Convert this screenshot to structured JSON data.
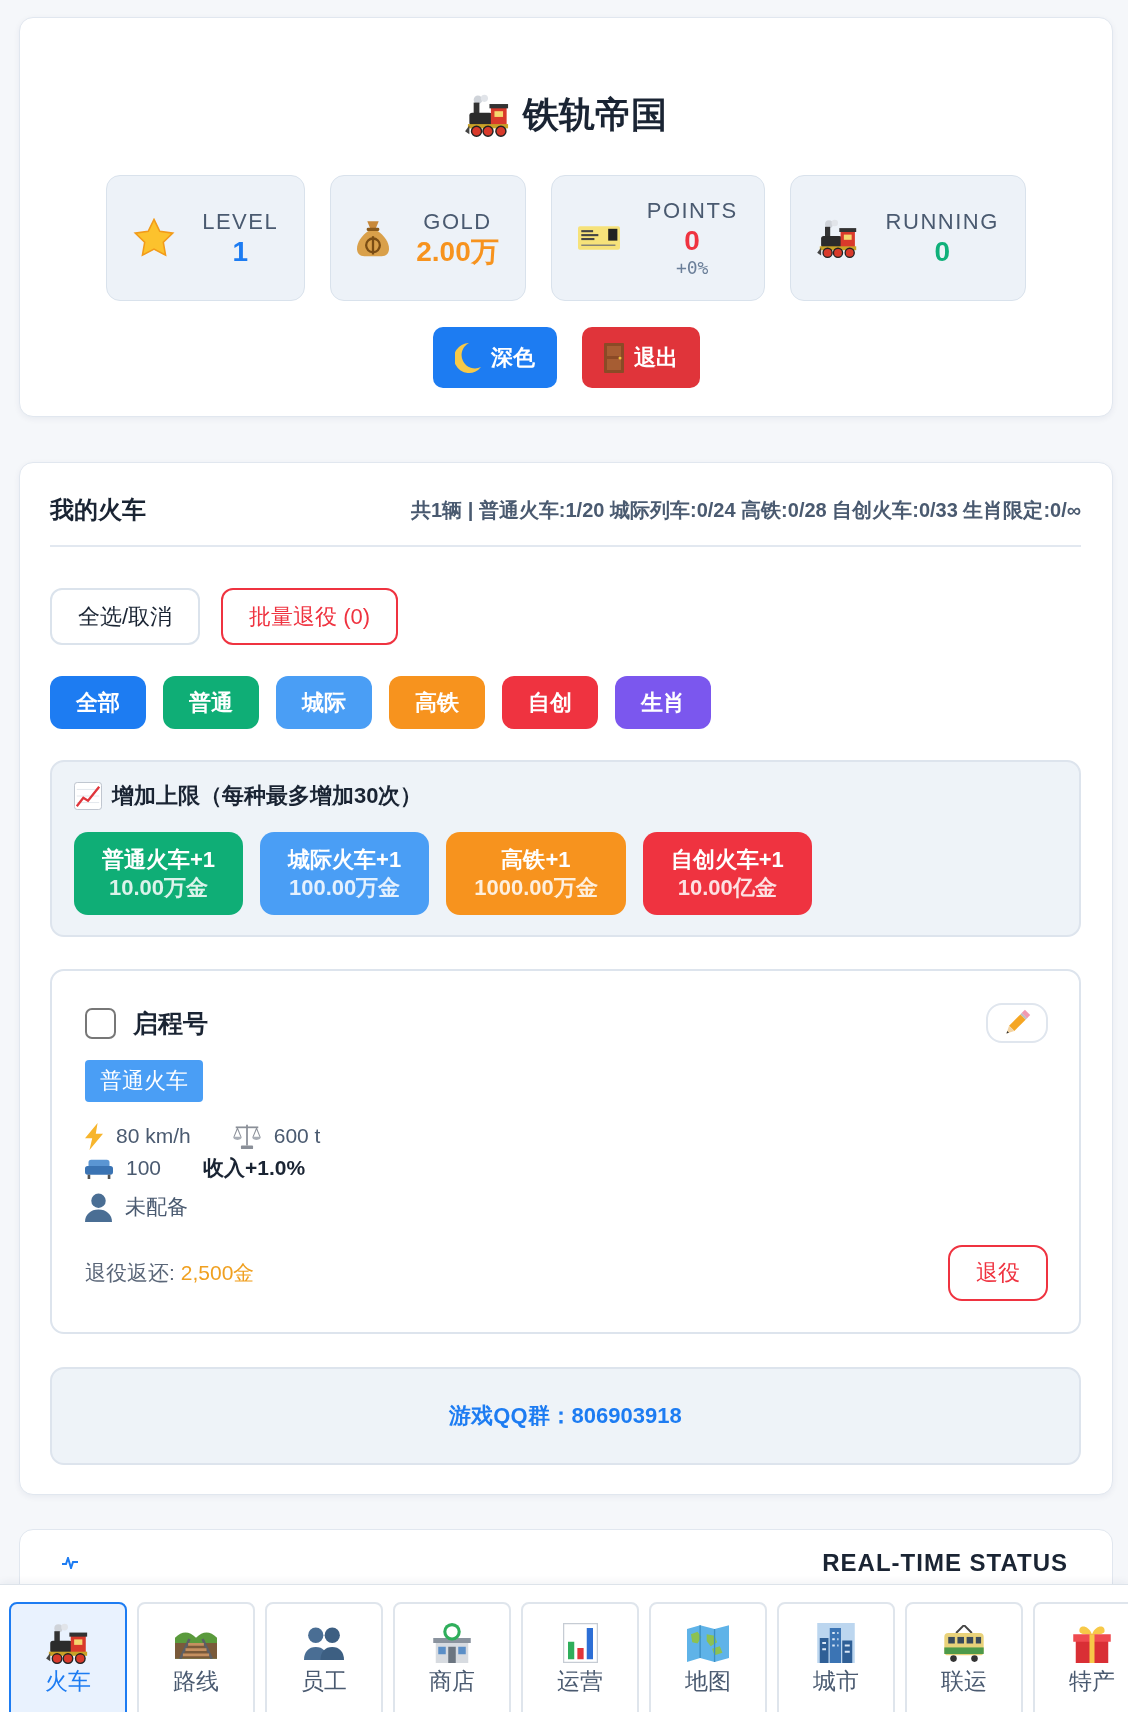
{
  "header": {
    "title": "铁轨帝国",
    "stats": [
      {
        "label": "LEVEL",
        "value": "1",
        "color": "#1d7cf2"
      },
      {
        "label": "GOLD",
        "value": "2.00万",
        "color": "#f7931e"
      },
      {
        "label": "POINTS",
        "value": "0",
        "bonus": "+0%",
        "color": "#ef3340"
      },
      {
        "label": "RUNNING",
        "value": "0",
        "color": "#10b07a"
      }
    ],
    "buttons": [
      {
        "label": "深色",
        "color": "#1d7cf2"
      },
      {
        "label": "退出",
        "color": "#e0343a"
      }
    ]
  },
  "trains": {
    "title": "我的火车",
    "summary": "共1辆 | 普通火车:1/20 城际列车:0/24 高铁:0/28 自创火车:0/33 生肖限定:0/∞",
    "actions": [
      {
        "label": "全选/取消",
        "kind": "neutral"
      },
      {
        "label": "批量退役 (0)",
        "kind": "danger"
      }
    ],
    "filters": [
      {
        "label": "全部",
        "color": "#1d7cf2"
      },
      {
        "label": "普通",
        "color": "#0fae76"
      },
      {
        "label": "城际",
        "color": "#4a9ef5"
      },
      {
        "label": "高铁",
        "color": "#f7931e"
      },
      {
        "label": "自创",
        "color": "#ef3340"
      },
      {
        "label": "生肖",
        "color": "#7b57ee"
      }
    ],
    "upgrade": {
      "title": "增加上限（每种最多增加30次）",
      "buttons": [
        {
          "label": "普通火车+1",
          "price": "10.00万金",
          "color": "#0fae76"
        },
        {
          "label": "城际火车+1",
          "price": "100.00万金",
          "color": "#4a9ef5"
        },
        {
          "label": "高铁+1",
          "price": "1000.00万金",
          "color": "#f7931e"
        },
        {
          "label": "自创火车+1",
          "price": "10.00亿金",
          "color": "#ef3340"
        }
      ]
    },
    "cards": [
      {
        "name": "启程号",
        "checked": false,
        "type": "普通火车",
        "speed": "80 km/h",
        "weight": "600 t",
        "seats": "100",
        "income": "收入+1.0%",
        "crew": "未配备",
        "refund_label": "退役返还:",
        "refund_value": "2,500金",
        "retire": "退役"
      }
    ],
    "qq": "游戏QQ群：806903918"
  },
  "status": {
    "title": "REAL-TIME STATUS"
  },
  "nav": [
    {
      "label": "火车",
      "selected": true
    },
    {
      "label": "路线",
      "selected": false
    },
    {
      "label": "员工",
      "selected": false
    },
    {
      "label": "商店",
      "selected": false
    },
    {
      "label": "运营",
      "selected": false
    },
    {
      "label": "地图",
      "selected": false
    },
    {
      "label": "城市",
      "selected": false
    },
    {
      "label": "联运",
      "selected": false
    },
    {
      "label": "特产",
      "selected": false
    }
  ]
}
